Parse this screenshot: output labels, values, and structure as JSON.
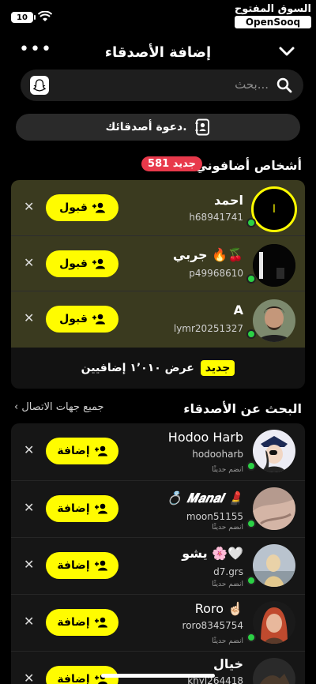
{
  "statusbar": {
    "battery": "10"
  },
  "watermark": {
    "arabic": "السوق المفتوح",
    "english": "OpenSooq"
  },
  "header": {
    "title": "إضافة الأصدقاء",
    "menu_glyph": "•••"
  },
  "search": {
    "placeholder": "بحث..."
  },
  "invite": {
    "label": "دعوة أصدقائك."
  },
  "added_me": {
    "title": "أشخاص أضافوني",
    "new_count": "581 جديد",
    "accept_label": "قبول",
    "rows": [
      {
        "name": "احمد",
        "username": "h68941741",
        "avatar_letter": "ا"
      },
      {
        "name": "جربي 🔥🍒",
        "username": "p49968610"
      },
      {
        "name": "A",
        "username": "lymr20251327"
      }
    ],
    "show_all_badge": "جديد",
    "show_all_text": "عرض ١٬٠١٠ إضافيين"
  },
  "find_friends": {
    "title": "البحث عن الأصدقاء",
    "all_contacts": "جميع جهات الاتصال",
    "add_label": "إضافة",
    "rows": [
      {
        "name": "Hodoo Harb",
        "username": "hodooharb",
        "sub": "انضم حديثًا"
      },
      {
        "name": "💍 𝑴𝒂𝒏𝒂𝒍 💄",
        "username": "moon51155",
        "sub": "انضم حديثًا"
      },
      {
        "name": "يشو 🌸🤍",
        "username": "d7.grs",
        "sub": "انضم حديثًا"
      },
      {
        "name": "Roro ☝🏻",
        "username": "roro8345754",
        "sub": "انضم حديثًا"
      },
      {
        "name": "خيال",
        "username": "khyl264418",
        "sub": ""
      }
    ]
  },
  "colors": {
    "accent": "#fffc00",
    "badge_red": "#e8394b",
    "online": "#2bd145"
  }
}
